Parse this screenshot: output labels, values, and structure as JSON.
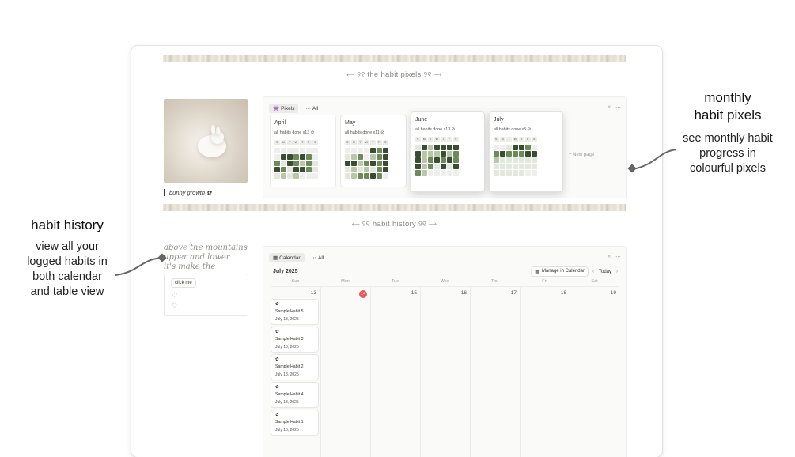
{
  "headers": {
    "habit_pixels": "⟵ ୨୧ the habit pixels ୨୧ ⟶",
    "habit_history": "⟵ ୨୧ habit history ୨୧ ⟶"
  },
  "cover": {
    "caption": "bunny growth ✿"
  },
  "pixels_view": {
    "tab_active": "Pixels",
    "tab_other": "All",
    "new_page": "+ New page",
    "dow": [
      "S",
      "M",
      "T",
      "W",
      "T",
      "F",
      "S"
    ],
    "months": [
      {
        "name": "April",
        "summary": "all habits done x13",
        "levels": [
          0,
          0,
          0,
          0,
          0,
          0,
          0,
          0,
          4,
          4,
          3,
          4,
          3,
          0,
          3,
          1,
          4,
          3,
          2,
          3,
          1,
          4,
          3,
          1,
          4,
          4,
          3,
          1,
          1,
          2,
          1,
          2,
          0,
          0,
          0
        ]
      },
      {
        "name": "May",
        "summary": "all habits done x11",
        "levels": [
          0,
          0,
          0,
          0,
          4,
          3,
          4,
          1,
          2,
          3,
          0,
          2,
          3,
          4,
          4,
          4,
          2,
          3,
          4,
          3,
          4,
          1,
          2,
          1,
          2,
          1,
          3,
          4,
          1,
          2,
          3,
          3,
          4,
          3,
          0
        ]
      },
      {
        "name": "June",
        "summary": "all habits done x13",
        "levels": [
          1,
          4,
          2,
          4,
          4,
          4,
          4,
          4,
          2,
          2,
          2,
          4,
          2,
          3,
          4,
          2,
          3,
          4,
          3,
          4,
          3,
          4,
          2,
          3,
          1,
          4,
          1,
          4,
          3,
          2,
          0,
          0,
          0,
          0,
          0
        ]
      },
      {
        "name": "July",
        "summary": "all habits done x5",
        "levels": [
          0,
          0,
          1,
          4,
          4,
          3,
          0,
          3,
          4,
          3,
          3,
          3,
          4,
          4,
          2,
          1,
          1,
          1,
          1,
          1,
          1,
          1,
          1,
          1,
          1,
          1,
          1,
          1,
          1,
          1,
          1,
          1,
          1,
          0,
          0
        ]
      }
    ],
    "palette": [
      "#eeeeec",
      "#e3e8dc",
      "#b7c7a8",
      "#6e8a5c",
      "#3b4d30"
    ]
  },
  "sidebar_widget": {
    "script_lines": [
      "above the mountains",
      "upper and lower",
      "it's make the"
    ],
    "button": "click me",
    "hearts": [
      "♡",
      "♡"
    ]
  },
  "calendar": {
    "tab_active": "Calendar",
    "tab_other": "All",
    "month": "July 2025",
    "manage": "Manage in Calendar",
    "today": "Today",
    "weekdays": [
      "Sun",
      "Mon",
      "Tue",
      "Wed",
      "Thu",
      "Fri",
      "Sat"
    ],
    "dates": [
      "13",
      "14",
      "15",
      "16",
      "17",
      "18",
      "19"
    ],
    "today_index": 1,
    "events": [
      {
        "icon": "✿",
        "name": "Sample Habit 5",
        "date": "July 13, 2025"
      },
      {
        "icon": "✿",
        "name": "Sample Habit 3",
        "date": "July 13, 2025"
      },
      {
        "icon": "✿",
        "name": "Sample Habit 2",
        "date": "July 13, 2025"
      },
      {
        "icon": "✿",
        "name": "Sample Habit 4",
        "date": "July 13, 2025"
      },
      {
        "icon": "✿",
        "name": "Sample Habit 1",
        "date": "July 13, 2025"
      }
    ]
  },
  "annotations": {
    "right_title_1": "monthly",
    "right_title_2": "habit pixels",
    "right_body_1": "see monthly habit",
    "right_body_2": "progress in",
    "right_body_3": "colourful pixels",
    "left_title": "habit history",
    "left_body_1": "view all your",
    "left_body_2": "logged habits in",
    "left_body_3": "both calendar",
    "left_body_4": "and table view"
  }
}
